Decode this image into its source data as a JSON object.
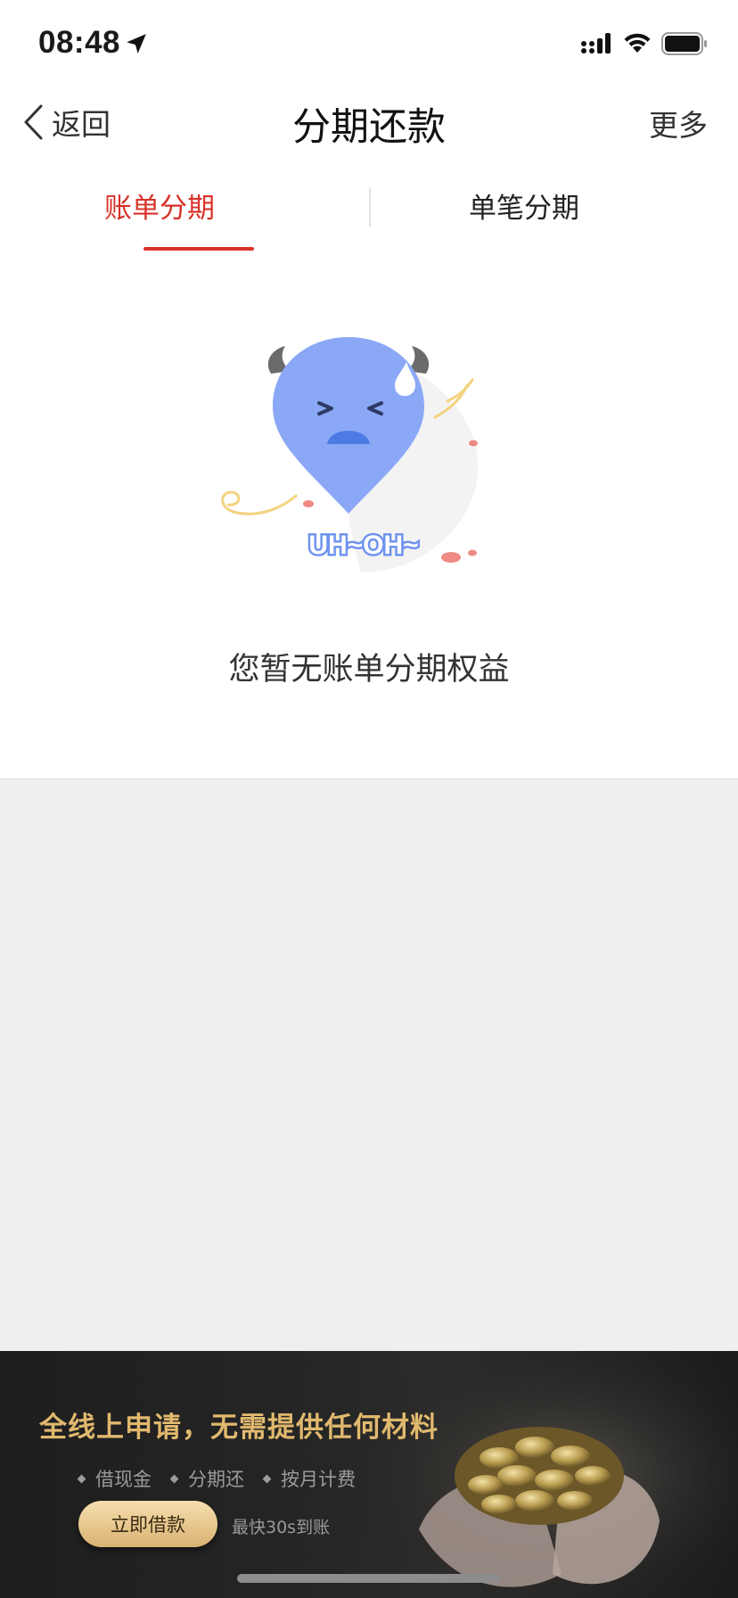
{
  "status_bar": {
    "time": "08:48",
    "icons": [
      "location-arrow-icon",
      "cellular-signal-icon",
      "wifi-icon",
      "battery-icon"
    ]
  },
  "nav": {
    "back_label": "返回",
    "title": "分期还款",
    "more_label": "更多"
  },
  "tabs": [
    {
      "label": "账单分期",
      "active": true
    },
    {
      "label": "单笔分期",
      "active": false
    }
  ],
  "empty_state": {
    "illustration_text": "UH~OH~",
    "message": "您暂无账单分期权益"
  },
  "banner": {
    "headline": "全线上申请，无需提供任何材料",
    "features": [
      "借现金",
      "分期还",
      "按月计费"
    ],
    "cta_label": "立即借款",
    "cta_note": "最快30s到账"
  },
  "colors": {
    "accent": "#d8322a",
    "banner_gold": "#e1b96e",
    "mascot_blue": "#8aa8f5"
  }
}
